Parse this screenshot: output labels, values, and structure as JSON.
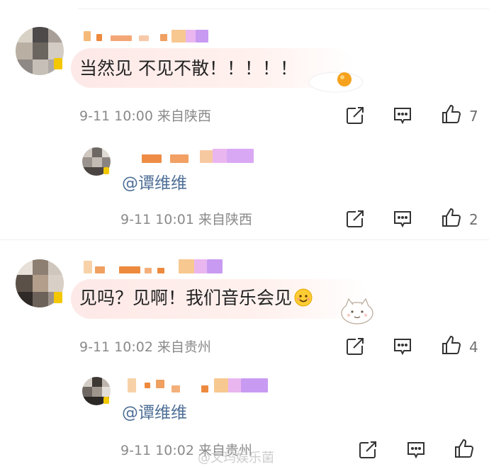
{
  "comments": [
    {
      "text": "当然见 不见不散！！！！！",
      "time": "9-11 10:00",
      "location": "来自陕西",
      "like_count": "7",
      "reply": {
        "mention": "@谭维维",
        "time": "9-11 10:01",
        "location": "来自陕西",
        "like_count": "2"
      }
    },
    {
      "text": "见吗？见啊！我们音乐会见",
      "time": "9-11 10:02",
      "location": "来自贵州",
      "like_count": "4",
      "reply": {
        "mention": "@谭维维",
        "time": "9-11 10:02",
        "location": "来自贵州",
        "like_count": ""
      }
    }
  ],
  "watermark": "@文玛娱乐菌",
  "icons": {
    "share": "share-icon",
    "comment": "comment-icon",
    "like": "thumbs-up-icon",
    "emoji_1": "fried-egg-emoji",
    "emoji_2": "cat-stamp-emoji",
    "emoji_3": "smiling-face-emoji"
  },
  "colors": {
    "mention": "#4f6f97",
    "meta": "#8a8a8a",
    "bubble": "#fde9e7"
  }
}
